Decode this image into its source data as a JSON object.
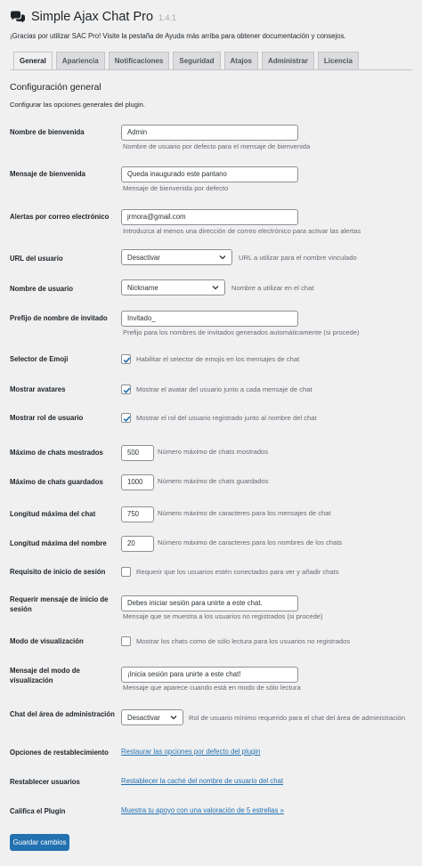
{
  "header": {
    "title": "Simple Ajax Chat Pro",
    "version": "1.4.1",
    "icon": "chat-bubbles-icon"
  },
  "intro": "¡Gracias por utilizar SAC Pro! Visite la pestaña de Ayuda más arriba para obtener documentación y consejos.",
  "tabs": [
    {
      "label": "General",
      "active": true
    },
    {
      "label": "Apariencia"
    },
    {
      "label": "Notificaciones"
    },
    {
      "label": "Seguridad"
    },
    {
      "label": "Atajos"
    },
    {
      "label": "Administrar"
    },
    {
      "label": "Licencia"
    }
  ],
  "section": {
    "title": "Configuración general",
    "description": "Configurar las opciones generales del plugin."
  },
  "fields": {
    "welcome_name": {
      "label": "Nombre de bienvenida",
      "value": "Admin",
      "desc": "Nombre de usuario por defecto para el mensaje de bienvenida"
    },
    "welcome_message": {
      "label": "Mensaje de bienvenida",
      "value": "Queda inaugurado este pantano",
      "desc": "Mensaje de bienvenida por defecto"
    },
    "email_alerts": {
      "label": "Alertas por correo electrónico",
      "value": "jrmora@gmail.com",
      "desc": "Introduzca al menos una dirección de correo electrónico para activar las alertas"
    },
    "user_url": {
      "label": "URL del usuario",
      "selected": "Desactivar",
      "desc": "URL a utilizar para el nombre vinculado"
    },
    "username": {
      "label": "Nombre de usuario",
      "selected": "Nickname",
      "desc": "Nombre a utilizar en el chat"
    },
    "guest_prefix": {
      "label": "Prefijo de nombre de invitado",
      "value": "Invitado_",
      "desc": "Prefijo para los nombres de invitados generados automáticamente (si procede)"
    },
    "emoji": {
      "label": "Selector de Emoji",
      "checked": true,
      "desc": "Habilitar el selector de emojis en los mensajes de chat"
    },
    "avatars": {
      "label": "Mostrar avatares",
      "checked": true,
      "desc": "Mostrar el avatar del usuario junto a cada mensaje de chat"
    },
    "user_role": {
      "label": "Mostrar rol de usuario",
      "checked": true,
      "desc": "Mostrar el rol del usuario registrado junto al nombre del chat"
    },
    "max_shown": {
      "label": "Máximo de chats mostrados",
      "value": "500",
      "desc": "Número máximo de chats mostrados"
    },
    "max_saved": {
      "label": "Máximo de chats guardados",
      "value": "1000",
      "desc": "Número máximo de chats guardados"
    },
    "max_length_chat": {
      "label": "Longitud máxima del chat",
      "value": "750",
      "desc": "Número máximo de caracteres para los mensajes de chat"
    },
    "max_length_name": {
      "label": "Longitud máxima del nombre",
      "value": "20",
      "desc": "Número máximo de caracteres para los nombres de los chats"
    },
    "login_required": {
      "label": "Requisito de inicio de sesión",
      "checked": false,
      "desc": "Requerir que los usuarios estén conectados para ver y añadir chats"
    },
    "login_message": {
      "label": "Requerir mensaje de inicio de sesión",
      "value": "Debes iniciar sesión para unirte a este chat.",
      "desc": "Mensaje que se muestra a los usuarios no registrados (si procede)"
    },
    "view_mode": {
      "label": "Modo de visualización",
      "checked": false,
      "desc": "Mostrar los chats como de sólo lectura para los usuarios no registrados"
    },
    "view_mode_message": {
      "label": "Mensaje del modo de visualización",
      "value": "¡Inicia sesión para unirte a este chat!",
      "desc": "Mensaje que aparece cuando está en modo de sólo lectura"
    },
    "admin_chat": {
      "label": "Chat del área de administración",
      "selected": "Desactivar",
      "desc": "Rol de usuario mínimo requerido para el chat del área de administración"
    },
    "reset_options": {
      "label": "Opciones de restablecimiento",
      "link": "Restaurar las opciones por defecto del plugin"
    },
    "reset_users": {
      "label": "Restablecer usuarios",
      "link": "Restablecer la caché del nombre de usuario del chat"
    },
    "rate": {
      "label": "Califica el Plugin",
      "link": "Muestra tu apoyo con una valoración de 5 estrellas »"
    }
  },
  "save_button": "Guardar cambios",
  "colors": {
    "accent": "#2271b1",
    "background": "#f0f0f1"
  }
}
